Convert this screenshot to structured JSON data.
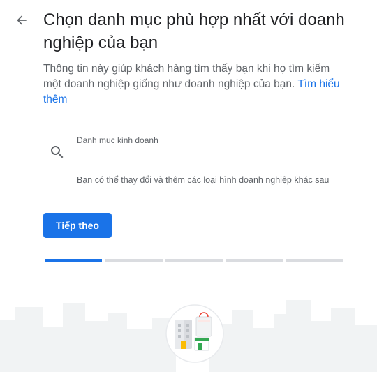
{
  "header": {
    "title": "Chọn danh mục phù hợp nhất với doanh nghiệp của bạn",
    "subtitle": "Thông tin này giúp khách hàng tìm thấy bạn khi họ tìm kiếm một doanh nghiệp giống như doanh nghiệp của bạn.",
    "learn_more": "Tìm hiểu thêm"
  },
  "form": {
    "category_label": "Danh mục kinh doanh",
    "category_value": "",
    "helper_text": "Bạn có thể thay đổi và thêm các loại hình doanh nghiệp khác sau"
  },
  "actions": {
    "next_label": "Tiếp theo"
  },
  "progress": {
    "total_steps": 5,
    "current_step": 1
  },
  "icons": {
    "back": "arrow-back-icon",
    "search": "search-icon",
    "illustration": "business-storefront-illustration"
  },
  "colors": {
    "accent": "#1a73e8",
    "text_primary": "#202124",
    "text_secondary": "#5f6368",
    "divider": "#dadce0",
    "skyline": "#f1f3f4"
  }
}
